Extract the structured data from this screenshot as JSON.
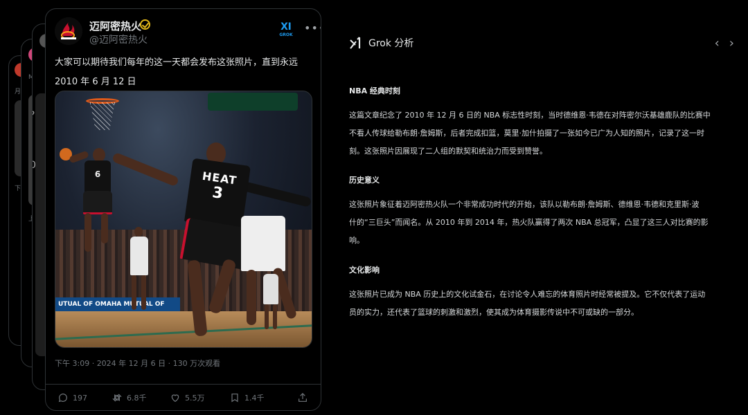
{
  "background_cards": {
    "fragments": [
      "月",
      "M",
      "?",
      "0",
      "下",
      "上"
    ]
  },
  "tweet": {
    "author_name": "迈阿密热火",
    "author_handle": "@迈阿密热火",
    "grok_badge": "GROK",
    "more_icon": "more-icon",
    "text": "大家可以期待我们每年的这一天都会发布这张照片，直到永远",
    "date_line": "2010 年 6 月 12 日",
    "photo": {
      "jersey_front": "HEAT",
      "jersey_number": "3",
      "jersey_back_number": "6",
      "banner_text": "UTUAL OF OMAHA  MUTUAL OF OMAHA"
    },
    "meta": "下午 3:09 · 2024 年 12 月 6 日 · 130 万次观看",
    "actions": {
      "reply_count": "197",
      "retweet_count": "6.8千",
      "like_count": "5.5万",
      "bookmark_count": "1.4千"
    }
  },
  "grok": {
    "title": "Grok 分析",
    "sections": [
      {
        "heading": "NBA 经典时刻",
        "lines": [
          "这篇文章纪念了 2010 年 12 月 6 日的 NBA 标志性时刻，当时德维恩·韦德在对阵密尔沃基雄鹿队的比赛中",
          "不看人传球给勒布朗·詹姆斯，后者完成扣篮，莫里·加什拍摄了一张如今已广为人知的照片，记录了这一时",
          "刻。这张照片因展现了二人组的默契和统治力而受到赞誉。"
        ]
      },
      {
        "heading": "历史意义",
        "lines": [
          "这张照片象征着迈阿密热火队一个非常成功时代的开始，该队以勒布朗·詹姆斯、德维恩·韦德和克里斯·波",
          "什的“三巨头”而闻名。从 2010 年到 2014 年，热火队赢得了两次 NBA 总冠军，凸显了这三人对比赛的影",
          "响。"
        ]
      },
      {
        "heading": "文化影响",
        "lines": [
          "这张照片已成为 NBA 历史上的文化试金石，在讨论令人难忘的体育照片时经常被提及。它不仅代表了运动",
          "员的实力，还代表了篮球的刺激和激烈，使其成为体育摄影传说中不可或缺的一部分。"
        ]
      }
    ]
  },
  "colors": {
    "background": "#000000",
    "border": "#2f3336",
    "text_primary": "#e7e9ea",
    "text_secondary": "#71767b",
    "verified_gold": "#e2b719",
    "grok_blue": "#1d9bf0",
    "heat_red": "#c8102e"
  }
}
